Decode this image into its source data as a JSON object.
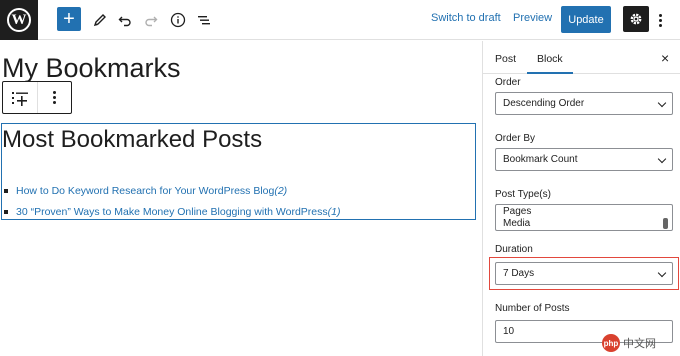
{
  "toolbar": {
    "logo_letter": "W",
    "add_symbol": "+",
    "switch_to_draft": "Switch to draft",
    "preview": "Preview",
    "update": "Update"
  },
  "editor": {
    "page_title": "My Bookmarks",
    "block_heading": "Most Bookmarked Posts",
    "posts": [
      {
        "title": "How to Do Keyword Research for Your WordPress Blog",
        "count": "(2)"
      },
      {
        "title": "30 “Proven” Ways to Make Money Online Blogging with WordPress",
        "count": "(1)"
      }
    ]
  },
  "sidebar": {
    "tabs": [
      {
        "label": "Post"
      },
      {
        "label": "Block"
      }
    ],
    "close_symbol": "×",
    "fields": {
      "order": {
        "label": "Order",
        "value": "Descending Order"
      },
      "order_by": {
        "label": "Order By",
        "value": "Bookmark Count"
      },
      "post_types": {
        "label": "Post Type(s)",
        "options": [
          "Pages",
          "Media"
        ]
      },
      "duration": {
        "label": "Duration",
        "value": "7 Days"
      },
      "number_of_posts": {
        "label": "Number of Posts",
        "value": "10"
      }
    }
  },
  "watermark": {
    "badge": "php",
    "text": "中文网"
  },
  "colors": {
    "accent": "#2271b1",
    "dark": "#1e1e1e",
    "highlight": "#e2483d"
  }
}
